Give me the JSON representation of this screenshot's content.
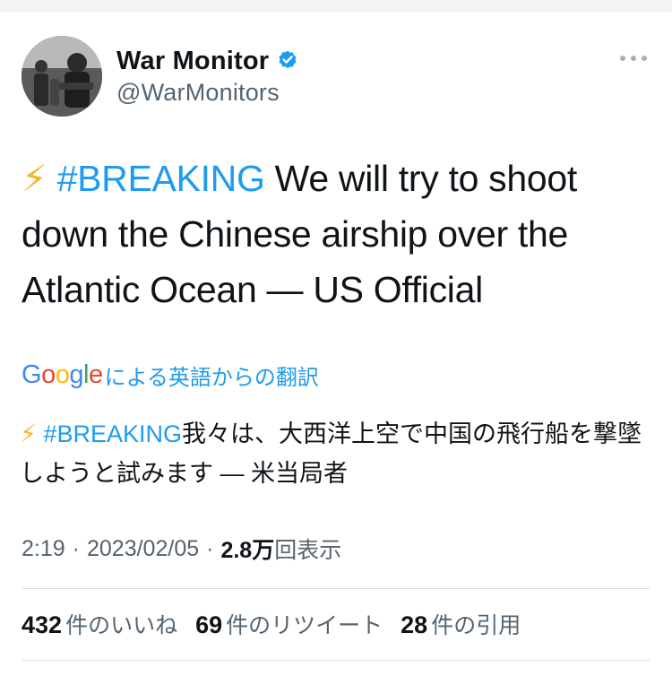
{
  "author": {
    "display_name": "War Monitor",
    "handle": "@WarMonitors",
    "verified": true
  },
  "tweet": {
    "bolt": "⚡",
    "hashtag": "#BREAKING",
    "body": " We will try to shoot down the Chinese airship over the Atlantic Ocean — US Official"
  },
  "translation": {
    "provider": "Google",
    "label": "による英語からの翻訳",
    "bolt": "⚡",
    "hashtag": "#BREAKING",
    "body": "我々は、大西洋上空で中国の飛行船を撃墜しようと試みます — 米当局者"
  },
  "meta": {
    "time": "2:19",
    "dot": "·",
    "date": "2023/02/05",
    "views_count": "2.8万",
    "views_label": "回表示"
  },
  "stats": {
    "likes_count": "432",
    "likes_label": "件のいいね",
    "retweets_count": "69",
    "retweets_label": "件のリツイート",
    "quotes_count": "28",
    "quotes_label": "件の引用"
  },
  "colors": {
    "link_blue": "#1d9bf0",
    "secondary_text": "#536471",
    "bolt_yellow": "#f5b625"
  },
  "icons": {
    "verified": "verified-badge-icon",
    "more": "more-horizontal-icon"
  }
}
